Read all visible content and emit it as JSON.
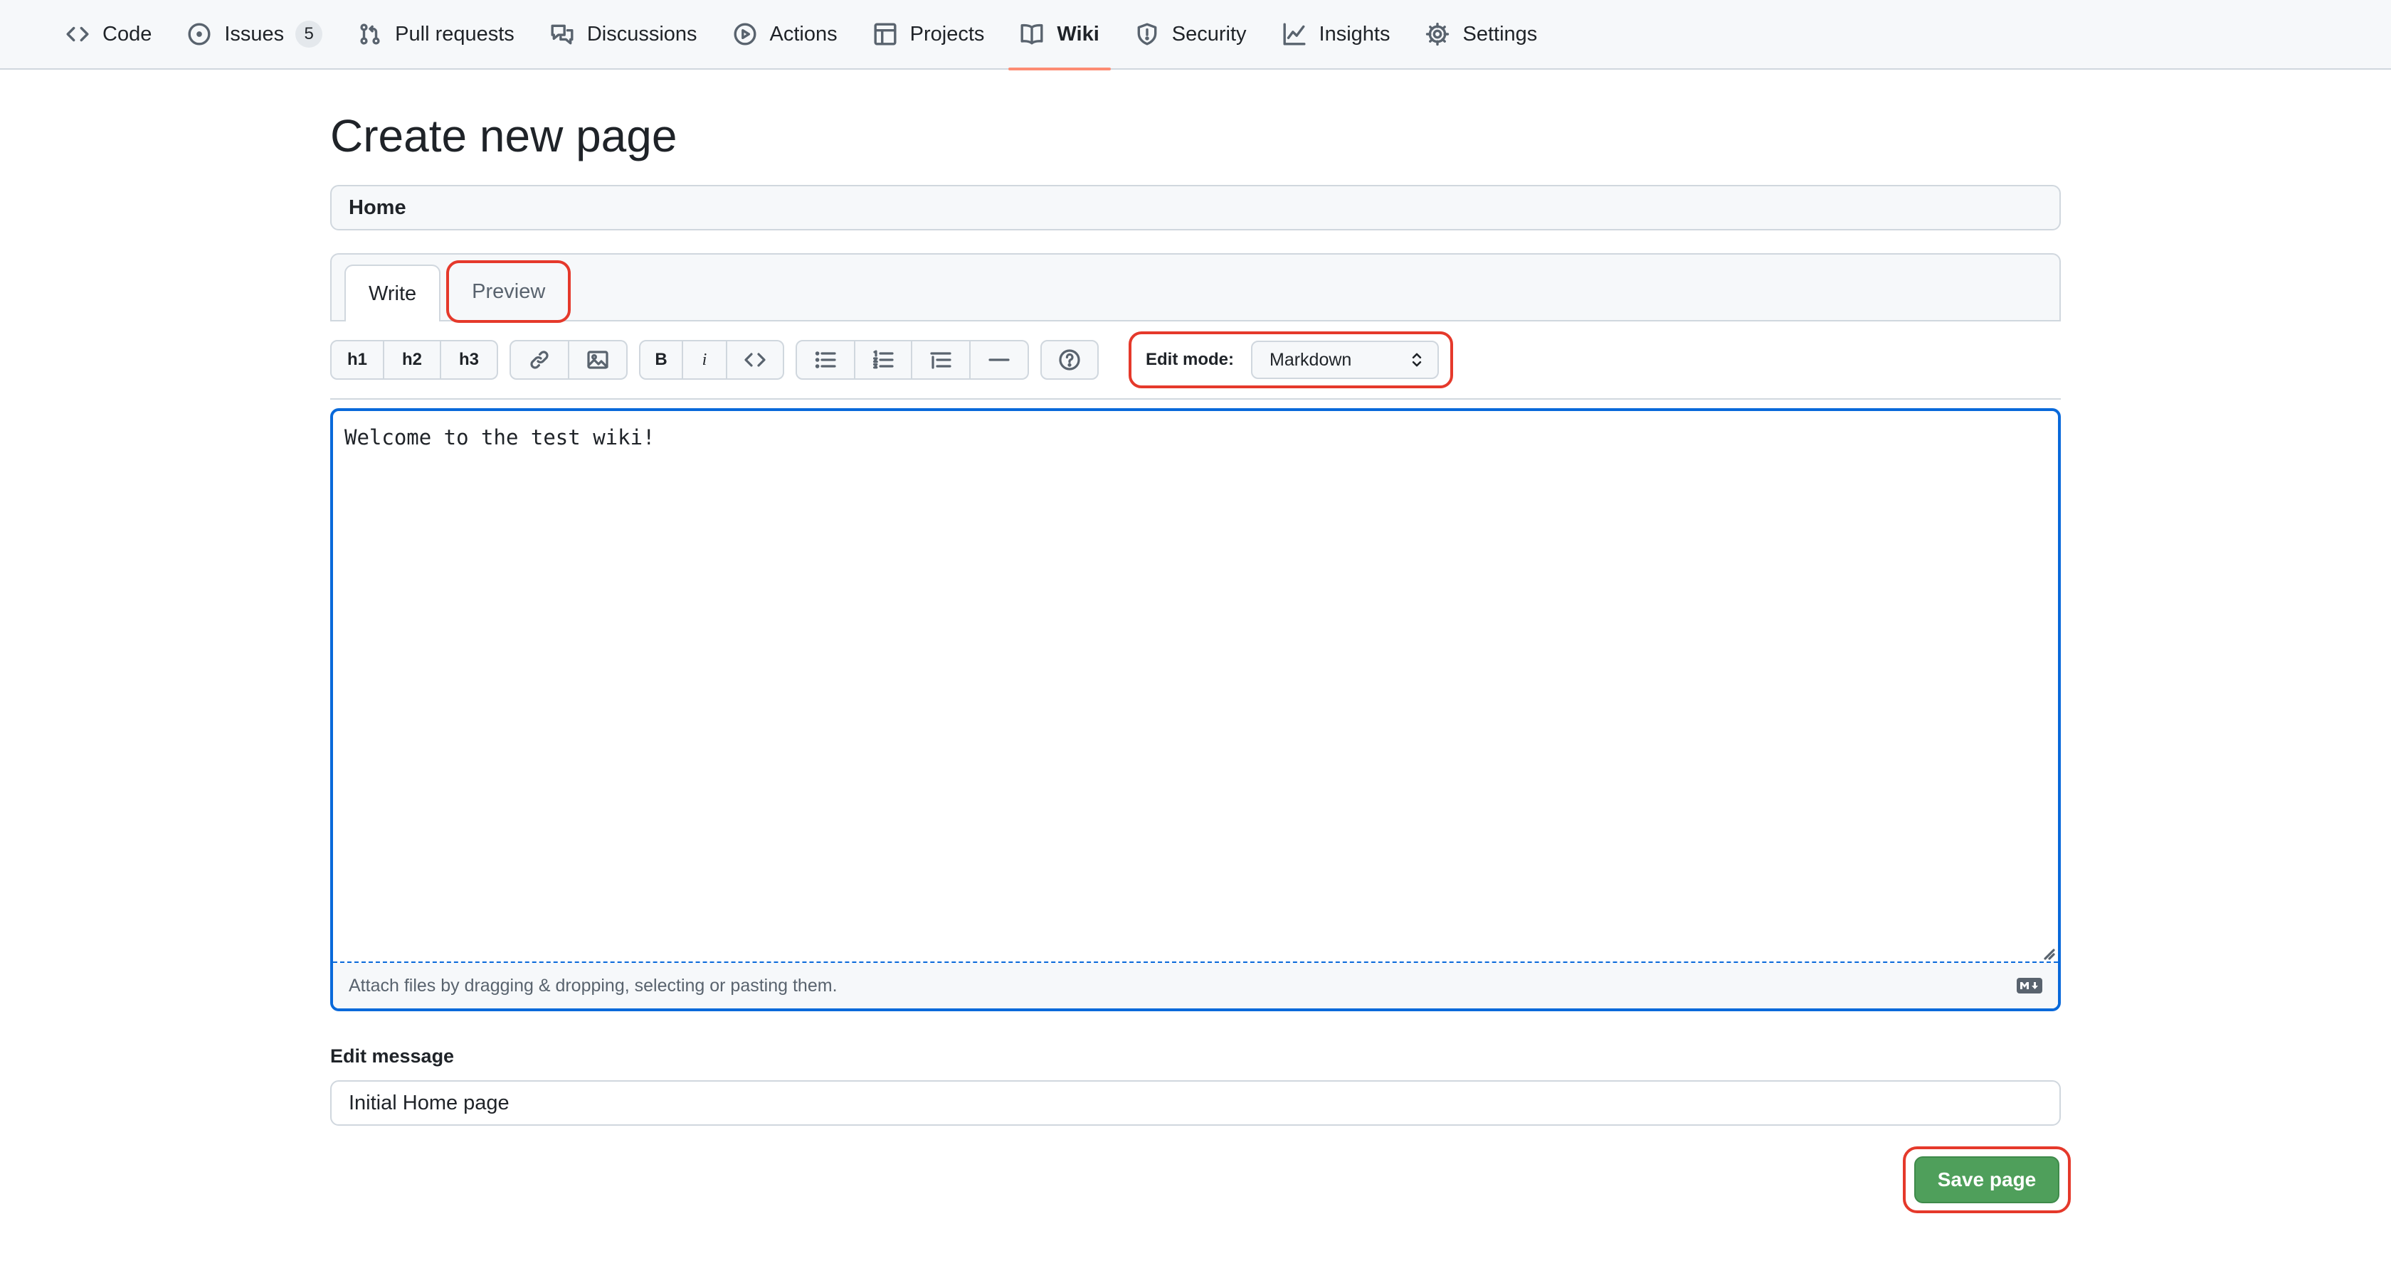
{
  "nav": {
    "items": [
      {
        "label": "Code",
        "icon": "code-icon"
      },
      {
        "label": "Issues",
        "icon": "issue-opened-icon",
        "count": "5"
      },
      {
        "label": "Pull requests",
        "icon": "git-pull-request-icon"
      },
      {
        "label": "Discussions",
        "icon": "comment-discussion-icon"
      },
      {
        "label": "Actions",
        "icon": "play-icon"
      },
      {
        "label": "Projects",
        "icon": "table-icon"
      },
      {
        "label": "Wiki",
        "icon": "book-icon",
        "selected": true
      },
      {
        "label": "Security",
        "icon": "shield-icon"
      },
      {
        "label": "Insights",
        "icon": "graph-icon"
      },
      {
        "label": "Settings",
        "icon": "gear-icon"
      }
    ]
  },
  "page": {
    "title": "Create new page",
    "page_name_value": "Home"
  },
  "tabs": {
    "write": "Write",
    "preview": "Preview"
  },
  "toolbar": {
    "h1": "h1",
    "h2": "h2",
    "h3": "h3",
    "bold": "B",
    "italic": "i",
    "edit_mode_label": "Edit mode:",
    "edit_mode_value": "Markdown"
  },
  "editor": {
    "content": "Welcome to the test wiki!",
    "attach_hint": "Attach files by dragging & dropping, selecting or pasting them."
  },
  "message": {
    "label": "Edit message",
    "value": "Initial Home page"
  },
  "actions": {
    "save": "Save page"
  },
  "colors": {
    "accent_blue": "#0969da",
    "nav_underline": "#fd8c73",
    "save_green": "#4f9f5b",
    "highlight_red": "#e5392b"
  }
}
